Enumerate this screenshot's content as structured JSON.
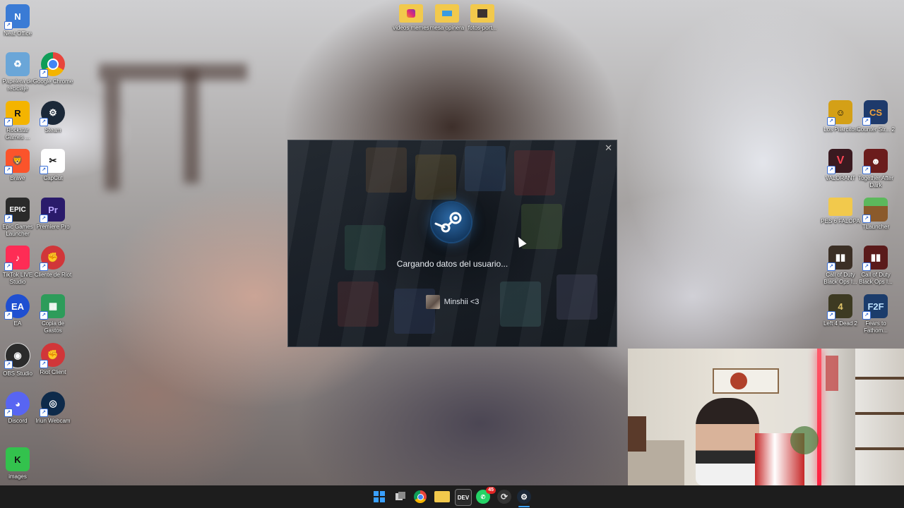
{
  "desktop": {
    "icons_left": [
      {
        "label": "Neat Office",
        "icon": "neat-office-icon",
        "color": "#3a7bd5"
      },
      {
        "label": "Papelera de reciclaje",
        "icon": "recycle-bin-icon",
        "color": "#6aa6d8"
      },
      {
        "label": "Google Chrome",
        "icon": "chrome-icon",
        "color": "#e8453c"
      },
      {
        "label": "Rockstar Games ...",
        "icon": "rockstar-icon",
        "color": "#f4b400"
      },
      {
        "label": "Steam",
        "icon": "steam-icon",
        "color": "#1b2838"
      },
      {
        "label": "Brave",
        "icon": "brave-icon",
        "color": "#fb542b"
      },
      {
        "label": "CapCut",
        "icon": "capcut-icon",
        "color": "#111111"
      },
      {
        "label": "Epic Games Launcher",
        "icon": "epic-games-icon",
        "color": "#2a2a2a"
      },
      {
        "label": "Premiere Pro",
        "icon": "premiere-pro-icon",
        "color": "#2a1b6b"
      },
      {
        "label": "TikTok LIVE Studio",
        "icon": "tiktok-icon",
        "color": "#fe2c55"
      },
      {
        "label": "Cliente de Riot",
        "icon": "riot-icon",
        "color": "#d13639"
      },
      {
        "label": "EA",
        "icon": "ea-icon",
        "color": "#1f4fd1"
      },
      {
        "label": "Copia de Gastos",
        "icon": "spreadsheet-icon",
        "color": "#2d9c5a"
      },
      {
        "label": "OBS Studio",
        "icon": "obs-icon",
        "color": "#2b2b2b"
      },
      {
        "label": "Riot Client",
        "icon": "riot-icon",
        "color": "#d13639"
      },
      {
        "label": "Discord",
        "icon": "discord-icon",
        "color": "#5865f2"
      },
      {
        "label": "Iriun Webcam",
        "icon": "webcam-icon",
        "color": "#0e2a4a"
      },
      {
        "label": "images",
        "icon": "image-folder-icon",
        "color": "#33c24d"
      }
    ],
    "icons_top": [
      {
        "label": "videos memes",
        "icon": "folder-icon",
        "color": "#f2c94c"
      },
      {
        "label": "mesa opinera",
        "icon": "folder-icon",
        "color": "#f2c94c"
      },
      {
        "label": "fotos-port...",
        "icon": "folder-icon",
        "color": "#f2c94c"
      }
    ],
    "icons_right": [
      {
        "label": "Los Pilarcitos",
        "icon": "game-icon",
        "color": "#d4a017"
      },
      {
        "label": "Counter Str... 2",
        "icon": "cs2-icon",
        "color": "#1e3a6b"
      },
      {
        "label": "VALORANT",
        "icon": "valorant-icon",
        "color": "#fa4454"
      },
      {
        "label": "Together After Dark",
        "icon": "game-icon",
        "color": "#6b1c1c"
      },
      {
        "label": "PES 6 FALOPA",
        "icon": "folder-icon",
        "color": "#f2c94c"
      },
      {
        "label": "TLauncher",
        "icon": "minecraft-icon",
        "color": "#4caf50"
      },
      {
        "label": "Call of Duty Black Ops I...",
        "icon": "cod-icon",
        "color": "#3b2f25"
      },
      {
        "label": "Call of Duty Black Ops I...",
        "icon": "cod-icon",
        "color": "#5a1a1a"
      },
      {
        "label": "Left 4 Dead 2",
        "icon": "l4d2-icon",
        "color": "#3d3a22"
      },
      {
        "label": "Fears to Fathom...",
        "icon": "f2f-icon",
        "color": "#1b3c6b"
      }
    ]
  },
  "steam_dialog": {
    "status_text": "Cargando datos del usuario...",
    "username": "Minshii <3",
    "close_glyph": "✕",
    "accent": "#2d6aa7"
  },
  "taskbar": {
    "items": [
      {
        "name": "start",
        "icon": "windows-start-icon",
        "color": "#3aa0ff"
      },
      {
        "name": "task-view",
        "icon": "task-view-icon",
        "color": "#555555"
      },
      {
        "name": "chrome",
        "icon": "chrome-icon",
        "color": "#e8453c"
      },
      {
        "name": "file-explorer",
        "icon": "folder-icon",
        "color": "#f2c94c"
      },
      {
        "name": "dev-tools",
        "icon": "dev-icon",
        "color": "#2b2b2b"
      },
      {
        "name": "whatsapp",
        "icon": "whatsapp-icon",
        "color": "#25d366",
        "badge": "45"
      },
      {
        "name": "riot-client",
        "icon": "riot-icon",
        "color": "#d13639"
      },
      {
        "name": "steam",
        "icon": "steam-icon",
        "color": "#1b2838"
      }
    ]
  }
}
